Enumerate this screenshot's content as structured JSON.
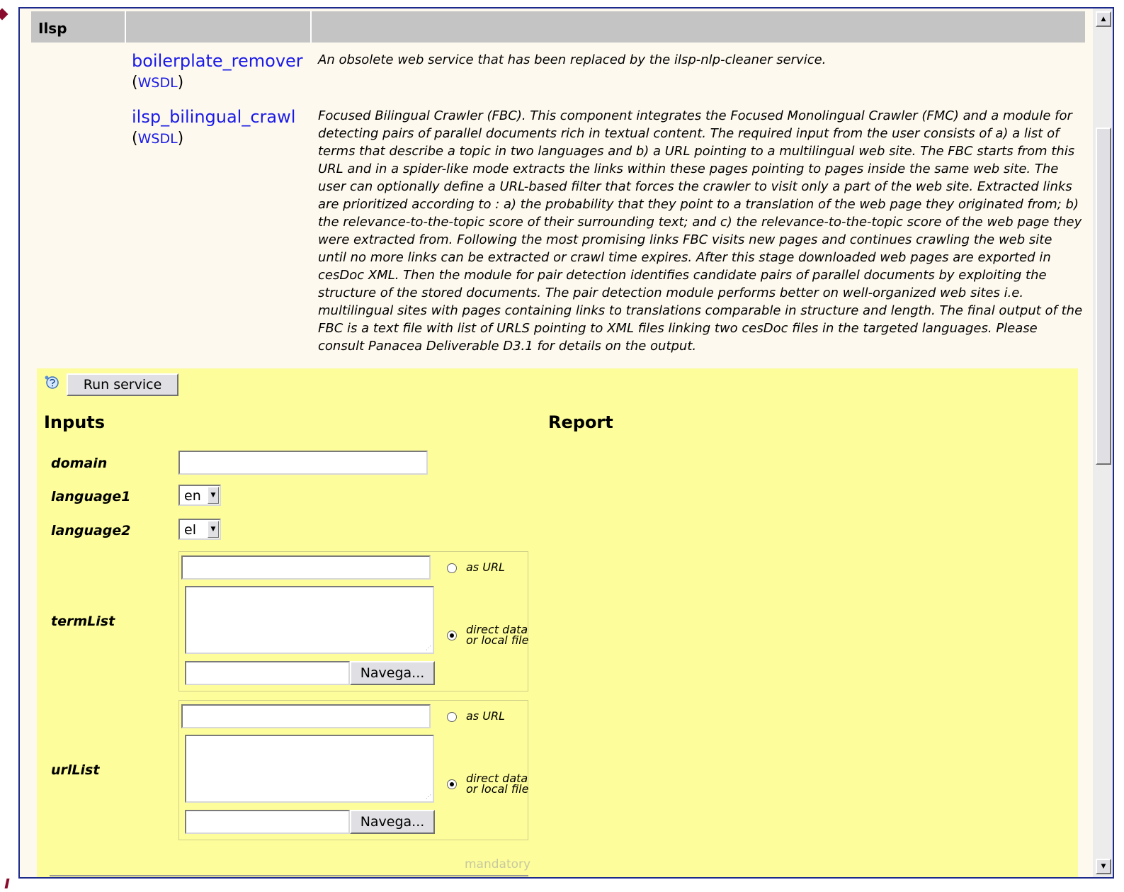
{
  "section": {
    "title": "Ilsp"
  },
  "services": [
    {
      "name": "boilerplate_remover",
      "wsdl_label": "WSDL",
      "description": "An obsolete web service that has been replaced by the ilsp-nlp-cleaner service."
    },
    {
      "name": "ilsp_bilingual_crawl",
      "wsdl_label": "WSDL",
      "description": "Focused Bilingual Crawler (FBC). This component integrates the Focused Monolingual Crawler (FMC) and a module for detecting pairs of parallel documents rich in textual content. The required input from the user consists of a) a list of terms that describe a topic in two languages and b) a URL pointing to a multilingual web site. The FBC starts from this URL and in a spider-like mode extracts the links within these pages pointing to pages inside the same web site. The user can optionally define a URL-based filter that forces the crawler to visit only a part of the web site. Extracted links are prioritized according to : a) the probability that they point to a translation of the web page they originated from; b) the relevance-to-the-topic score of their surrounding text; and c) the relevance-to-the-topic score of the web page they were extracted from. Following the most promising links FBC visits new pages and continues crawling the web site until no more links can be extracted or crawl time expires. After this stage downloaded web pages are exported in cesDoc XML. Then the module for pair detection identifies candidate pairs of parallel documents by exploiting the structure of the stored documents. The pair detection module performs better on well-organized web sites i.e. multilingual sites with pages containing links to translations comparable in structure and length. The final output of the FBC is a text file with list of URLS pointing to XML files linking two cesDoc files in the targeted languages. Please consult Panacea Deliverable D3.1 for details on the output."
    }
  ],
  "form": {
    "run_button": "Run service",
    "inputs_heading": "Inputs",
    "report_heading": "Report",
    "domain": {
      "label": "domain",
      "value": ""
    },
    "language1": {
      "label": "language1",
      "selected": "en"
    },
    "language2": {
      "label": "language2",
      "selected": "el"
    },
    "termList": {
      "label": "termList",
      "url_value": "",
      "as_url_label": "as URL",
      "direct_label_line1": "direct data",
      "direct_label_line2": "or local file",
      "direct_selected": true,
      "browse_label": "Navega..."
    },
    "urlList": {
      "label": "urlList",
      "url_value": "",
      "as_url_label": "as URL",
      "direct_label_line1": "direct data",
      "direct_label_line2": "or local file",
      "direct_selected": true,
      "browse_label": "Navega..."
    },
    "mandatory_note": "mandatory"
  },
  "colors": {
    "frame_border": "#1c2a8c",
    "header_bg": "#c4c4c4",
    "content_bg": "#fdf9ee",
    "form_bg": "#fdfd9b",
    "link": "#1a1ae6"
  }
}
